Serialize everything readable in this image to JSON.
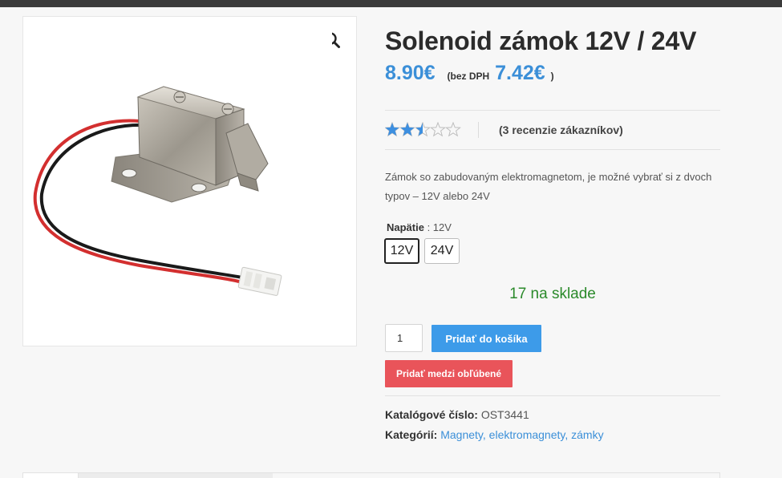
{
  "product": {
    "title": "Solenoid zámok 12V / 24V",
    "price": "8.90€",
    "net_label": "(bez DPH",
    "net_price": "7.42€",
    "net_close": ")",
    "rating": {
      "value": 2.5,
      "max": 5,
      "color": "#3d8fe0"
    },
    "reviews_label": "(3 recenzie zákazníkov)",
    "description": "Zámok so zabudovaným elektromagnetom, je možné vybrať si z dvoch typov – 12V alebo 24V",
    "attribute_label": "Napätie",
    "attribute_value": " : 12V",
    "variants": [
      {
        "label": "12V",
        "selected": true
      },
      {
        "label": "24V",
        "selected": false
      }
    ],
    "stock": "17 na sklade",
    "quantity": "1",
    "add_to_cart": "Pridať do košíka",
    "add_to_favorites": "Pridať medzi obľúbené",
    "sku_label": "Katalógové číslo:",
    "sku_value": "OST3441",
    "categories_label": "Kategórií:",
    "categories": "Magnety, elektromagnety, zámky"
  },
  "icons": {
    "zoom": "magnifier-icon",
    "rating": "star-icon"
  },
  "colors": {
    "accent": "#3d9be9",
    "price": "#3b8fd8",
    "favorite": "#e9545a",
    "stock": "#2b8a2b"
  }
}
